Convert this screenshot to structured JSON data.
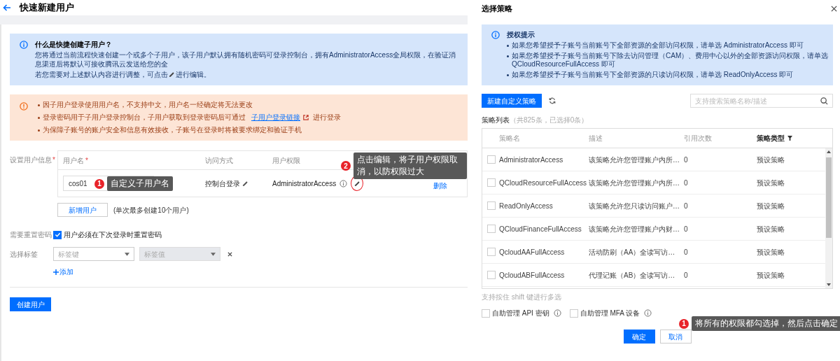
{
  "page": {
    "title": "快速新建用户"
  },
  "info_notice": {
    "title": "什么是快捷创建子用户？",
    "text": "您将通过当前流程快速创建一个或多个子用户，该子用户默认拥有随机密码可登录控制台，拥有AdministratorAccess全局权限，在验证消息渠道后将默认可接收腾讯云发送给您的全",
    "text_before_icon": "若您需要对上述默认内容进行调整，可点击",
    "text_after_icon": "进行编辑。"
  },
  "warning_notice": {
    "items": [
      {
        "text": "因子用户登录使用用户名，不支持中文，用户名一经确定将无法更改"
      },
      {
        "text": "登录密码用于子用户登录控制台，子用户获取到登录密码后可通过",
        "link": "子用户登录链接",
        "text_after": "进行登录"
      },
      {
        "text": "为保障子账号的账户安全和信息有效接收，子账号在登录时将被要求绑定和验证手机"
      }
    ]
  },
  "user_form": {
    "label": "设置用户信息",
    "label_required_mark": "*",
    "columns": [
      {
        "label": "用户名",
        "required_mark": "*"
      },
      {
        "label": "访问方式"
      },
      {
        "label": "用户权限"
      }
    ],
    "rows": [
      {
        "username": "cos01",
        "access": "控制台登录",
        "permission": "AdministratorAccess",
        "action": "删除",
        "username_annotation": {
          "number": "1",
          "text": "自定义子用户名"
        },
        "permission_annotation": {
          "number": "2",
          "text": "点击编辑，将子用户权限取消，以防权限过大"
        }
      }
    ],
    "add_button": "新增用户",
    "add_note": "(单次最多创建10个用户)"
  },
  "reset_password": {
    "label": "需要重置密码",
    "option": "用户必须在下次登录时重置密码",
    "checked": true
  },
  "tags": {
    "label": "选择标签",
    "key_placeholder": "标签键",
    "value_placeholder": "标签值",
    "value_disabled": true,
    "add": "添加"
  },
  "submit": "创建用户",
  "modal": {
    "title": "选择策略",
    "notice": {
      "title": "授权提示",
      "items": [
        "如果您希望授予子账号当前账号下全部资源的全部访问权限，请单选 AdministratorAccess 即可",
        "如果您希望授予子账号当前账号下除去访问管理（CAM）、费用中心以外的全部资源访问权限，请单选 QCloudResourceFullAccess 即可",
        "如果您希望授予子账号当前账号下全部资源的只读访问权限，请单选 ReadOnlyAccess 即可"
      ]
    },
    "new_button": "新建自定义策略",
    "search_placeholder": "支持搜索策略名称/描述",
    "list_label": "策略列表",
    "list_count": "（共825条，已选择0条）",
    "columns": [
      "策略名",
      "描述",
      "引用次数",
      "策略类型"
    ],
    "rows": [
      {
        "name": "AdministratorAccess",
        "description": "该策略允许您管理账户内所…",
        "references": "0",
        "type": "预设策略",
        "checked": false
      },
      {
        "name": "QCloudResourceFullAccess",
        "description": "该策略允许您管理账户内所…",
        "references": "0",
        "type": "预设策略",
        "checked": false
      },
      {
        "name": "ReadOnlyAccess",
        "description": "该策略允许您只读访问账户…",
        "references": "0",
        "type": "预设策略",
        "checked": false
      },
      {
        "name": "QCloudFinanceFullAccess",
        "description": "该策略允许您管理账户内财…",
        "references": "0",
        "type": "预设策略",
        "checked": false
      },
      {
        "name": "QcloudAAFullAccess",
        "description": "活动防刷（AA）全读写访…",
        "references": "0",
        "type": "预设策略",
        "checked": false
      },
      {
        "name": "QcloudABFullAccess",
        "description": "代理记账（AB）全读写访…",
        "references": "0",
        "type": "预设策略",
        "checked": false
      }
    ],
    "hint": "支持按住 shift 键进行多选",
    "options": [
      {
        "label": "自助管理 API 密钥",
        "checked": false
      },
      {
        "label": "自助管理 MFA 设备",
        "checked": false
      }
    ],
    "annotation": {
      "number": "1",
      "text": "将所有的权限都勾选掉，然后点击确定"
    },
    "confirm": "确定",
    "cancel": "取消"
  }
}
